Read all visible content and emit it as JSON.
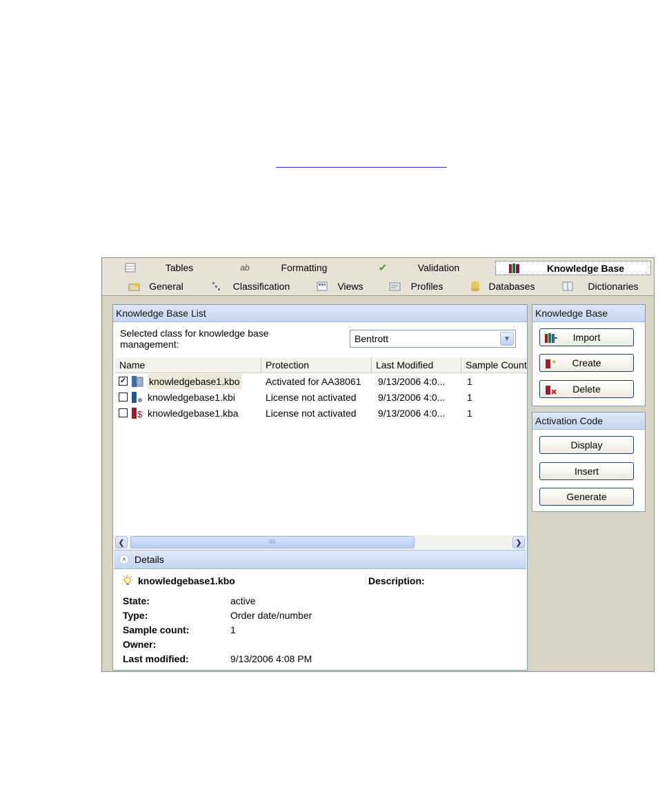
{
  "tabs_top": [
    {
      "label": "Tables",
      "icon": "table-icon"
    },
    {
      "label": "Formatting",
      "icon": "formatting-icon"
    },
    {
      "label": "Validation",
      "icon": "checkmark-icon"
    },
    {
      "label": "Knowledge Base",
      "icon": "books-icon",
      "active": true
    }
  ],
  "tabs_bottom": [
    {
      "label": "General",
      "icon": "general-icon"
    },
    {
      "label": "Classification",
      "icon": "classification-icon"
    },
    {
      "label": "Views",
      "icon": "views-icon"
    },
    {
      "label": "Profiles",
      "icon": "profiles-icon"
    },
    {
      "label": "Databases",
      "icon": "databases-icon"
    },
    {
      "label": "Dictionaries",
      "icon": "dictionaries-icon"
    }
  ],
  "kb_list": {
    "title": "Knowledge Base List",
    "class_label": "Selected class for knowledge base management:",
    "class_value": "Bentrott",
    "columns": [
      "Name",
      "Protection",
      "Last Modified",
      "Sample Count"
    ],
    "rows": [
      {
        "checked": true,
        "name": "knowledgebase1.kbo",
        "protection": "Activated for AA38061",
        "modified": "9/13/2006 4:0...",
        "count": "1",
        "icon": "kbo-book-icon"
      },
      {
        "checked": false,
        "name": "knowledgebase1.kbi",
        "protection": "License not activated",
        "modified": "9/13/2006 4:0...",
        "count": "1",
        "icon": "kbi-book-icon"
      },
      {
        "checked": false,
        "name": "knowledgebase1.kba",
        "protection": "License not activated",
        "modified": "9/13/2006 4:0...",
        "count": "1",
        "icon": "kba-book-icon"
      }
    ],
    "scroll_grip": "IIII"
  },
  "details": {
    "title": "Details",
    "name": "knowledgebase1.kbo",
    "description_label": "Description:",
    "fields": [
      {
        "key": "State:",
        "value": "active"
      },
      {
        "key": "Type:",
        "value": "Order date/number"
      },
      {
        "key": "Sample count:",
        "value": "1"
      },
      {
        "key": "Owner:",
        "value": ""
      },
      {
        "key": "Last modified:",
        "value": "9/13/2006 4:08 PM"
      }
    ]
  },
  "kb_actions": {
    "title": "Knowledge Base",
    "import": "Import",
    "create": "Create",
    "delete": "Delete"
  },
  "activation": {
    "title": "Activation Code",
    "display": "Display",
    "insert": "Insert",
    "generate": "Generate"
  }
}
